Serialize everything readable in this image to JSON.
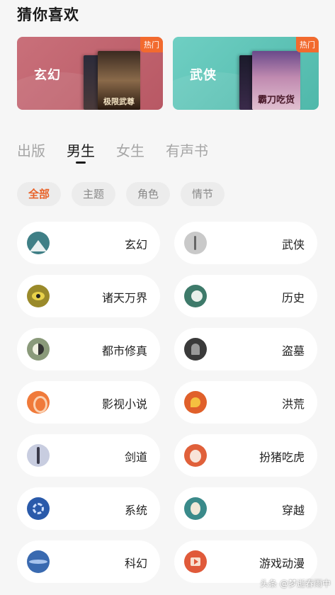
{
  "section": {
    "title": "猜你喜欢"
  },
  "banners": [
    {
      "label": "玄幻",
      "badge": "热门",
      "cover_title": "极限武尊"
    },
    {
      "label": "武侠",
      "badge": "热门",
      "cover_title": "霸刀吃货"
    }
  ],
  "tabs": [
    {
      "label": "出版",
      "active": false
    },
    {
      "label": "男生",
      "active": true
    },
    {
      "label": "女生",
      "active": false
    },
    {
      "label": "有声书",
      "active": false
    }
  ],
  "filters": [
    {
      "label": "全部",
      "active": true
    },
    {
      "label": "主题",
      "active": false
    },
    {
      "label": "角色",
      "active": false
    },
    {
      "label": "情节",
      "active": false
    }
  ],
  "categories": [
    {
      "label": "玄幻",
      "icon": "mountain-icon"
    },
    {
      "label": "武侠",
      "icon": "crane-icon"
    },
    {
      "label": "诸天万界",
      "icon": "eye-icon"
    },
    {
      "label": "历史",
      "icon": "history-icon"
    },
    {
      "label": "都市修真",
      "icon": "taiji-icon"
    },
    {
      "label": "盗墓",
      "icon": "tomb-icon"
    },
    {
      "label": "影视小说",
      "icon": "film-icon"
    },
    {
      "label": "洪荒",
      "icon": "bird-icon"
    },
    {
      "label": "剑道",
      "icon": "sword-icon"
    },
    {
      "label": "扮猪吃虎",
      "icon": "pig-icon"
    },
    {
      "label": "系统",
      "icon": "gear-icon"
    },
    {
      "label": "穿越",
      "icon": "travel-icon"
    },
    {
      "label": "科幻",
      "icon": "planet-icon"
    },
    {
      "label": "游戏动漫",
      "icon": "play-icon"
    }
  ],
  "watermark": "头条 @梦逝春雨中",
  "colors": {
    "accent": "#e8632a",
    "hot_badge": "#f26a2e",
    "banner_left": "#c9707a",
    "banner_right": "#6fcfc3"
  }
}
